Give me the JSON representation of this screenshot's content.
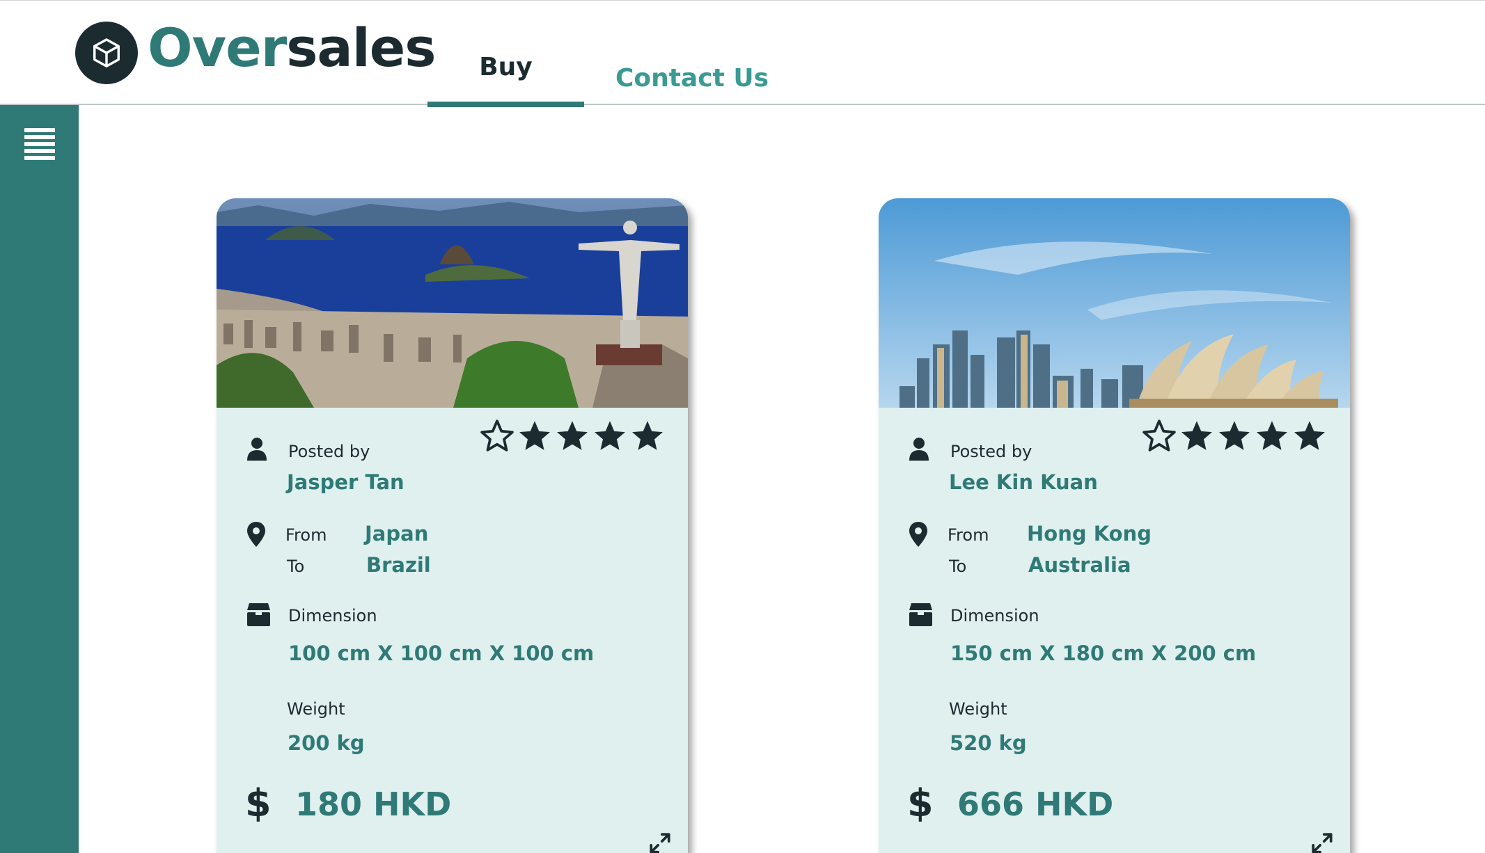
{
  "app": {
    "logo_part1": "Over",
    "logo_part2": "sales",
    "brand_color": "#2f7a76",
    "dark_color": "#1c2b30",
    "card_bg": "#dff0ef"
  },
  "nav": {
    "tabs": [
      {
        "label": "Buy",
        "active": true
      },
      {
        "label": "Contact Us",
        "active": false
      }
    ]
  },
  "sidebar": {
    "menu_icon": "hamburger-icon"
  },
  "listings": [
    {
      "image": "rio-de-janeiro-christ-statue",
      "posted_by_label": "Posted by",
      "poster": "Jasper Tan",
      "rating": 4,
      "rating_max": 5,
      "from_label": "From",
      "from": "Japan",
      "to_label": "To",
      "to": "Brazil",
      "dimension_label": "Dimension",
      "dimension": "100 cm X 100 cm X 100 cm",
      "weight_label": "Weight",
      "weight": "200 kg",
      "currency_symbol": "$",
      "price": "180 HKD"
    },
    {
      "image": "sydney-opera-house-skyline",
      "posted_by_label": "Posted by",
      "poster": "Lee Kin Kuan",
      "rating": 4,
      "rating_max": 5,
      "from_label": "From",
      "from": "Hong Kong",
      "to_label": "To",
      "to": "Australia",
      "dimension_label": "Dimension",
      "dimension": "150 cm X 180 cm X 200 cm",
      "weight_label": "Weight",
      "weight": "520 kg",
      "currency_symbol": "$",
      "price": "666 HKD"
    }
  ]
}
